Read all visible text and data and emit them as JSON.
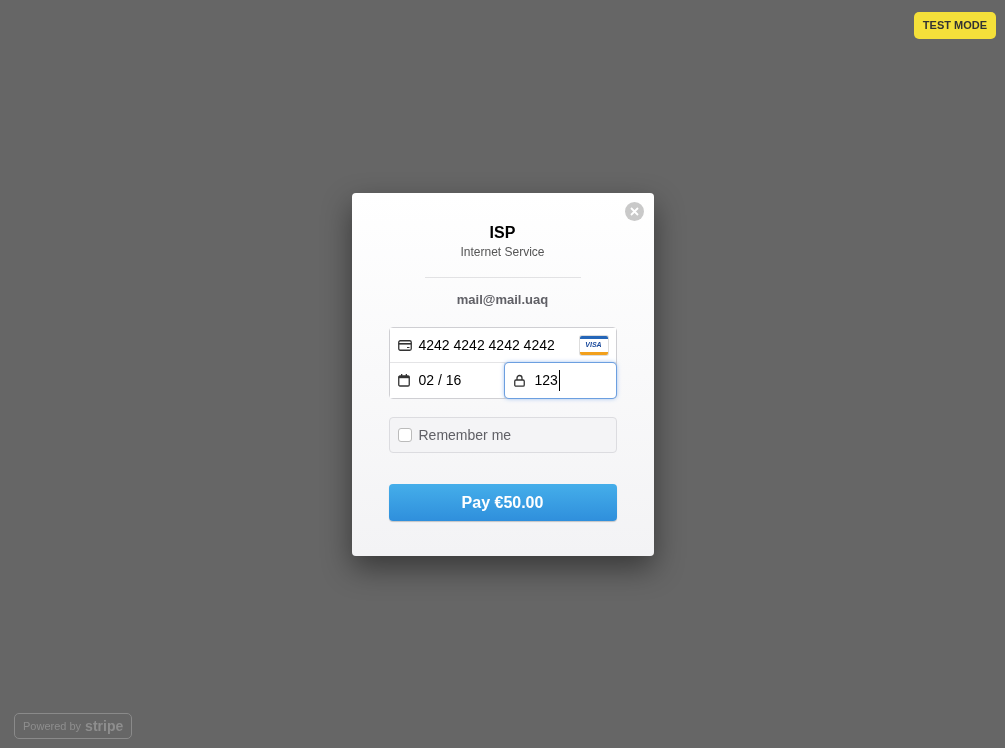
{
  "test_mode_badge": "TEST MODE",
  "dialog": {
    "title": "ISP",
    "subtitle": "Internet Service",
    "email": "mail@mail.uaq",
    "card_number": {
      "value": "4242 4242 4242 4242",
      "card_brand": "VISA",
      "focused": false
    },
    "expiry": {
      "value": "02 / 16",
      "focused": false
    },
    "cvc": {
      "value": "123",
      "focused": true
    },
    "remember_me": {
      "label": "Remember me",
      "checked": false
    },
    "pay_button": "Pay €50.00"
  },
  "footer": {
    "prefix": "Powered by",
    "brand": "stripe"
  }
}
